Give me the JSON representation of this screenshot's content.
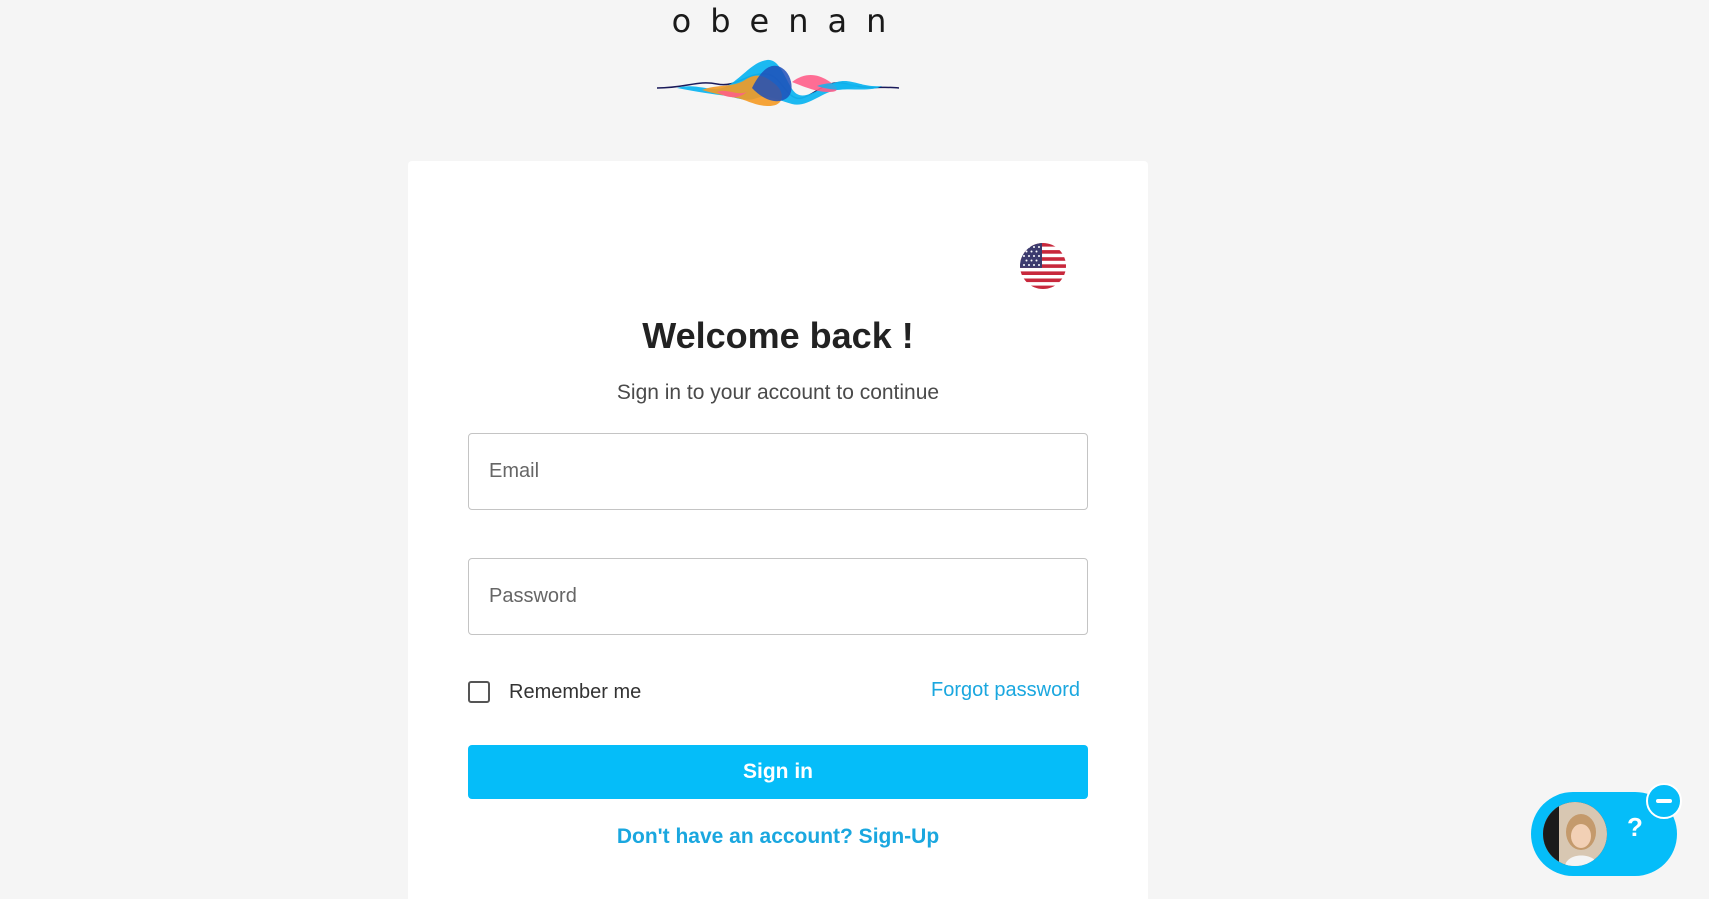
{
  "brand": {
    "name": "obenan"
  },
  "login": {
    "language_icon": "us-flag-icon",
    "title": "Welcome back !",
    "subtitle": "Sign in to your account to continue",
    "email_placeholder": "Email",
    "email_value": "",
    "password_placeholder": "Password",
    "password_value": "",
    "remember_label": "Remember me",
    "remember_checked": false,
    "forgot_label": "Forgot password",
    "signin_label": "Sign in",
    "signup_label": "Don't have an account? Sign-Up"
  },
  "chat_widget": {
    "help_label": "?",
    "avatar_icon": "agent-avatar",
    "minimize_icon": "minimize-icon"
  },
  "colors": {
    "accent": "#05bdf9",
    "link": "#1aa7df",
    "background": "#f5f5f5"
  }
}
